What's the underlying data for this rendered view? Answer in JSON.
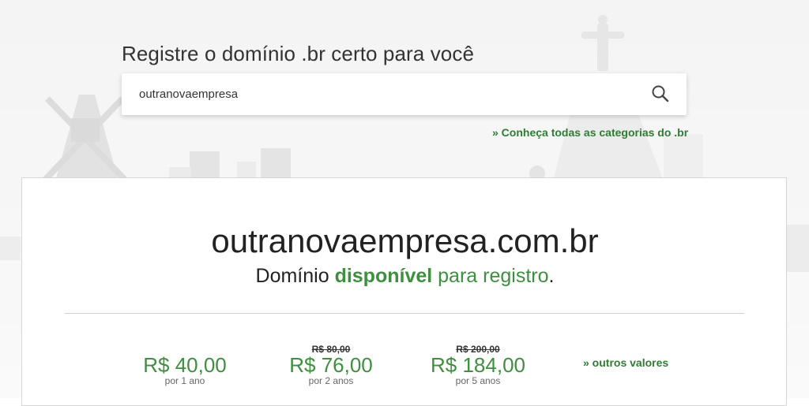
{
  "header": {
    "title": "Registre o domínio .br certo para você"
  },
  "search": {
    "value": "outranovaempresa",
    "button_icon": "search-icon"
  },
  "links": {
    "categories": "» Conheça todas as categorias do .br",
    "other_values": "» outros valores"
  },
  "result": {
    "domain": "outranovaempresa.com.br",
    "status_prefix": "Domínio",
    "status_word": "disponível",
    "status_suffix": "para registro",
    "status_end": "."
  },
  "prices": [
    {
      "old": "",
      "amount": "R$ 40,00",
      "period": "por 1 ano"
    },
    {
      "old": "R$ 80,00",
      "amount": "R$ 76,00",
      "period": "por 2 anos"
    },
    {
      "old": "R$ 200,00",
      "amount": "R$ 184,00",
      "period": "por 5 anos"
    }
  ],
  "colors": {
    "accent_green": "#3e8f3e",
    "link_green": "#2e7d32"
  }
}
